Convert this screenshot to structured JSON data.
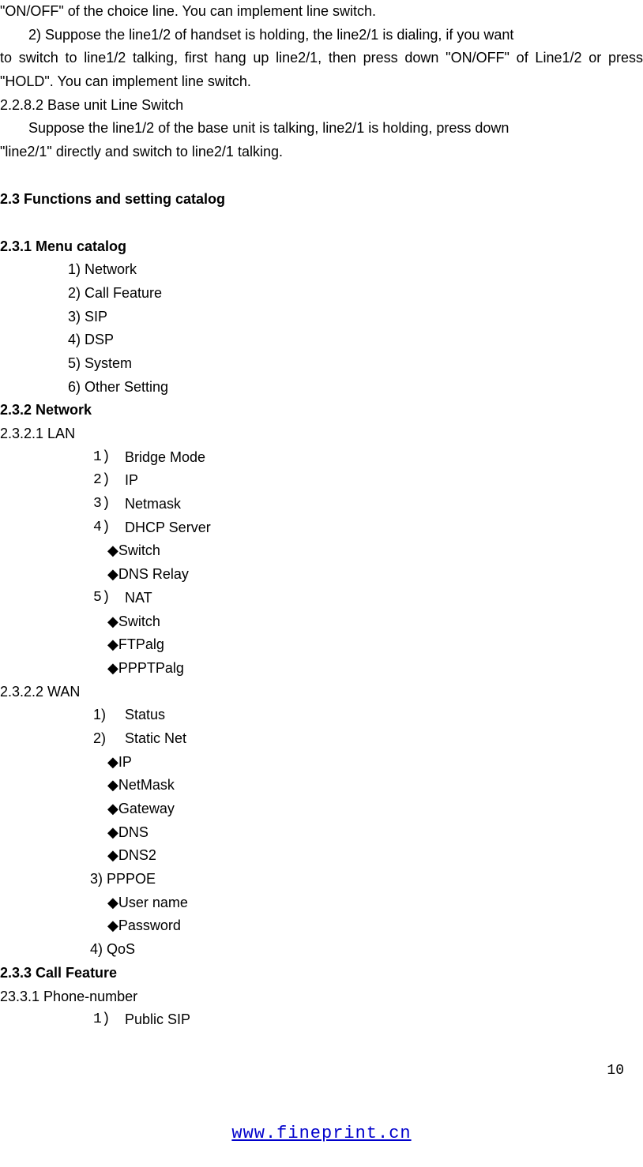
{
  "body": {
    "p1": "\"ON/OFF\" of the choice line. You can implement line switch.",
    "p2a": "2) Suppose the line1/2 of handset is holding, the line2/1 is dialing, if you want",
    "p2b": "to switch to line1/2 talking, first hang up line2/1, then press down \"ON/OFF\" of Line1/2 or press \"HOLD\". You can implement line switch.",
    "h2282": "2.2.8.2 Base unit Line Switch",
    "p3a": "Suppose the line1/2 of the base unit is talking, line2/1 is holding, press down",
    "p3b": "\"line2/1\" directly and switch to line2/1 talking."
  },
  "s23": {
    "title": "2.3 Functions and setting catalog"
  },
  "s231": {
    "title": "2.3.1 Menu catalog",
    "items": {
      "i1": "1) Network",
      "i2": "2) Call Feature",
      "i3": "3) SIP",
      "i4": "4) DSP",
      "i5": "5) System",
      "i6": "6) Other Setting"
    }
  },
  "s232": {
    "title": "2.3.2 Network",
    "lan": {
      "title": "2.3.2.1 LAN",
      "n1": {
        "num": "1)",
        "txt": "Bridge Mode"
      },
      "n2": {
        "num": "2)",
        "txt": "IP"
      },
      "n3": {
        "num": "3)",
        "txt": "Netmask"
      },
      "n4": {
        "num": "4)",
        "txt": "DHCP Server"
      },
      "b1": "◆Switch",
      "b2": "◆DNS Relay",
      "n5": {
        "num": "5)",
        "txt": " NAT"
      },
      "b3": "◆Switch",
      "b4": "◆FTPalg",
      "b5": "◆PPPTPalg"
    },
    "wan": {
      "title": "2.3.2.2 WAN",
      "n1": {
        "num": "1)",
        "txt": "Status"
      },
      "n2": {
        "num": "2)",
        "txt": "Static Net"
      },
      "b1": "◆IP",
      "b2": "◆NetMask",
      "b3": "◆Gateway",
      "b4": "◆DNS",
      "b5": "◆DNS2",
      "n3": "3) PPPOE",
      "b6": "◆User name",
      "b7": "◆Password",
      "n4": "4) QoS"
    }
  },
  "s233": {
    "title": "2.3.3 Call Feature",
    "sub": "23.3.1 Phone-number",
    "n1": {
      "num": "1)",
      "txt": "Public SIP"
    }
  },
  "footer": {
    "page": "10",
    "url": "www.fineprint.cn"
  }
}
